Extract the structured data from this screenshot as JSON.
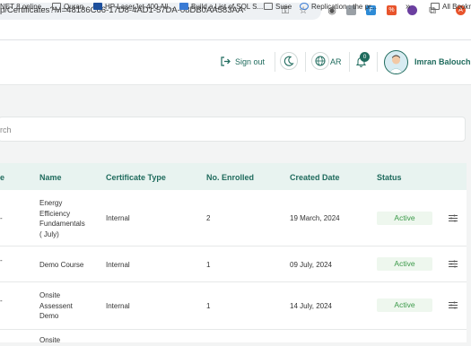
{
  "browser": {
    "url": "p/Certificates?M=48186C66-17D8-4AD1-57DA-08DB0AA583AA",
    "bookmarks": [
      "NET 8 online...",
      "Quran",
      "HP LaserJet 400 All...",
      "Build a List of SQL S...",
      "Suse",
      "Replication : the pr...",
      "All Bookm"
    ],
    "more": "»"
  },
  "header": {
    "sign_out": "Sign out",
    "language": "AR",
    "notification_count": "0",
    "user_name": "Imran Balouch"
  },
  "search": {
    "placeholder": "rch"
  },
  "table": {
    "columns": [
      "e",
      "Name",
      "Certificate Type",
      "No. Enrolled",
      "Created Date",
      "Status"
    ],
    "rows": [
      {
        "first": "-",
        "name_lines": [
          "Energy",
          "Efficiency",
          "Fundamentals",
          "( July)"
        ],
        "type": "Internal",
        "enrolled": "2",
        "date": "19 March, 2024",
        "status": "Active"
      },
      {
        "first": "-",
        "name_lines": [
          "Demo Course"
        ],
        "type": "Internal",
        "enrolled": "1",
        "date": "09 July, 2024",
        "status": "Active"
      },
      {
        "first": "-",
        "name_lines": [
          "Onsite",
          "Assessent",
          "Demo"
        ],
        "type": "Internal",
        "enrolled": "1",
        "date": "14 July, 2024",
        "status": "Active"
      },
      {
        "first": "",
        "name_lines": [
          "Onsite"
        ],
        "type": "",
        "enrolled": "",
        "date": "",
        "status": ""
      }
    ]
  },
  "colors": {
    "brand": "#1f6b5d",
    "active_text": "#3c9a4a",
    "active_bg": "#eef7ee",
    "header_bg": "#e8f3f0"
  },
  "icons": [
    "sign-out-icon",
    "moon-icon",
    "globe-icon",
    "bell-icon",
    "filter-actions-icon"
  ]
}
